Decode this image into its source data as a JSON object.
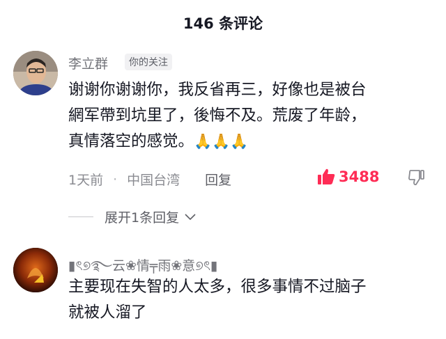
{
  "header": {
    "title": "146 条评论"
  },
  "comments": [
    {
      "username": "李立群",
      "tag": "你的关注",
      "lines": [
        "谢谢你谢谢你，我反省再三，好像也是被台",
        "網军帶到坑里了，後悔不及。荒废了年龄，",
        "真情落空的感觉。"
      ],
      "emoji": "🙏🙏🙏",
      "time": "1天前",
      "separator": "·",
      "location": "中国台湾",
      "reply_label": "回复",
      "likes": "3488",
      "expand_label": "展开1条回复"
    },
    {
      "username": "▮ৎ୭࿐云❀情╤雨❀意୭ৎ▮",
      "lines": [
        "主要现在失智的人太多，很多事情不过脑子",
        "就被人溜了"
      ]
    }
  ],
  "colors": {
    "like_active": "#fe2c55",
    "meta_gray": "#8a8b91"
  }
}
